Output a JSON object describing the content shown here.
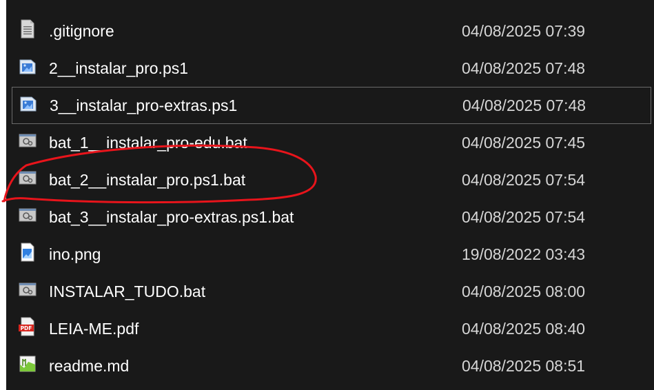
{
  "files": [
    {
      "name": ".gitignore",
      "modified": "04/08/2025 07:39",
      "icon": "text-file-icon"
    },
    {
      "name": "2__instalar_pro.ps1",
      "modified": "04/08/2025 07:48",
      "icon": "powershell-script-icon"
    },
    {
      "name": "3__instalar_pro-extras.ps1",
      "modified": "04/08/2025 07:48",
      "icon": "powershell-script-icon",
      "focused": true
    },
    {
      "name": "bat_1__instalar_pro-edu.bat",
      "modified": "04/08/2025 07:45",
      "icon": "batch-file-icon"
    },
    {
      "name": "bat_2__instalar_pro.ps1.bat",
      "modified": "04/08/2025 07:54",
      "icon": "batch-file-icon",
      "circled": true
    },
    {
      "name": "bat_3__instalar_pro-extras.ps1.bat",
      "modified": "04/08/2025 07:54",
      "icon": "batch-file-icon"
    },
    {
      "name": "ino.png",
      "modified": "19/08/2022 03:43",
      "icon": "image-file-icon"
    },
    {
      "name": "INSTALAR_TUDO.bat",
      "modified": "04/08/2025 08:00",
      "icon": "batch-file-icon"
    },
    {
      "name": "LEIA-ME.pdf",
      "modified": "04/08/2025 08:40",
      "icon": "pdf-file-icon"
    },
    {
      "name": "readme.md",
      "modified": "04/08/2025 08:51",
      "icon": "markdown-file-icon"
    }
  ],
  "colors": {
    "background": "#191919",
    "text": "#ffffff",
    "date_text": "#d6d6d6",
    "focus_border": "#6b6b6b",
    "annotation": "#e8141b"
  }
}
